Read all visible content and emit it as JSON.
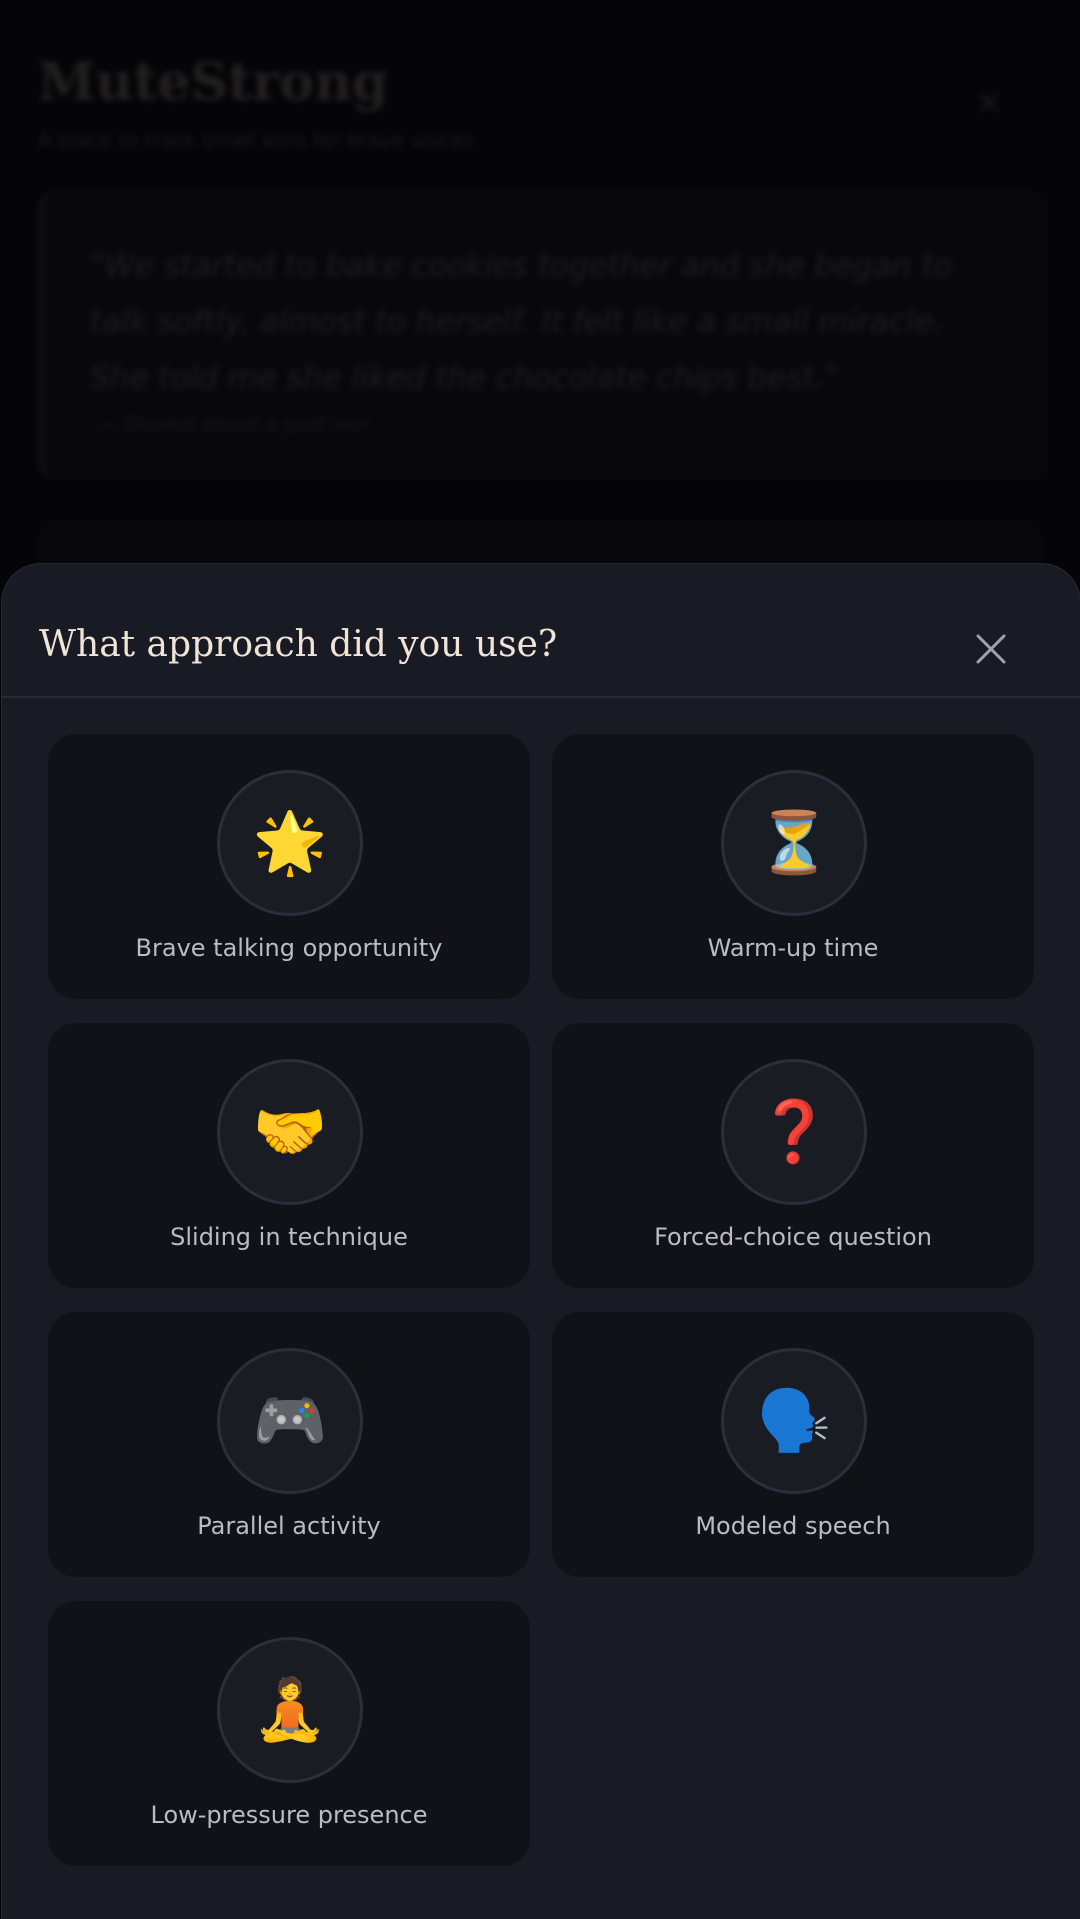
{
  "background": {
    "title": "MuteStrong",
    "subtitle": "A place to track small wins for brave voices",
    "quote": "\"We started to bake cookies together and she began to talk softly, almost to herself. It felt like a small miracle. She told me she liked the chocolate chips best.\"",
    "meta": "— Shared about a past win"
  },
  "sheet": {
    "title": "What approach did you use?",
    "close_icon": "close-icon"
  },
  "options": [
    {
      "label": "Brave talking opportunity",
      "emoji": "🌟",
      "icon": "glowing-star-icon"
    },
    {
      "label": "Warm-up time",
      "emoji": "⏳",
      "icon": "hourglass-icon"
    },
    {
      "label": "Sliding in technique",
      "emoji": "🤝",
      "icon": "handshake-icon"
    },
    {
      "label": "Forced-choice question",
      "emoji": "❓",
      "icon": "question-mark-icon"
    },
    {
      "label": "Parallel activity",
      "emoji": "🎮",
      "icon": "game-controller-icon"
    },
    {
      "label": "Modeled speech",
      "emoji": "🗣️",
      "icon": "speaking-head-icon"
    },
    {
      "label": "Low-pressure presence",
      "emoji": "🧘",
      "icon": "meditation-icon"
    }
  ],
  "colors": {
    "sheet_bg": "#191b24",
    "card_bg": "#111217",
    "title_color": "#f1e4d6",
    "label_color": "#b8bcc7"
  }
}
